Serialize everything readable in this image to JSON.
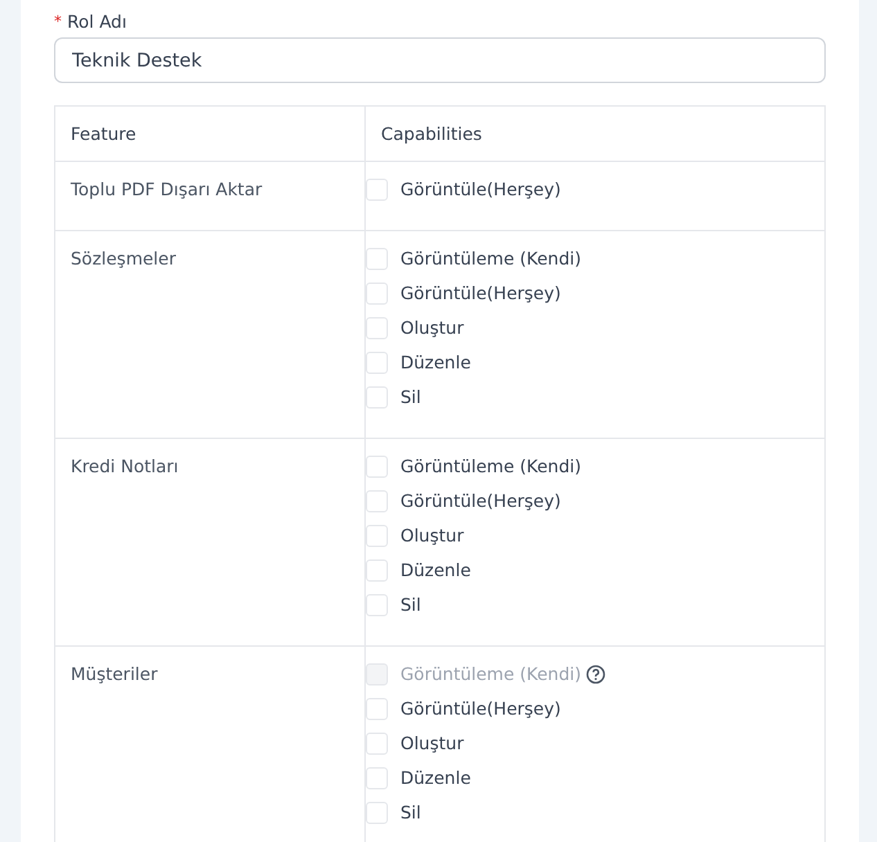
{
  "form": {
    "label": "Rol Adı",
    "required_mark": "*",
    "value": "Teknik Destek"
  },
  "table": {
    "columns": [
      "Feature",
      "Capabilities"
    ],
    "rows": [
      {
        "feature": "Toplu PDF Dışarı Aktar",
        "capabilities": [
          {
            "kind": "plain",
            "label": "Görüntüle(Herşey)",
            "checked": false,
            "disabled": false
          }
        ]
      },
      {
        "feature": "Sözleşmeler",
        "capabilities": [
          {
            "kind": "plain",
            "label": "Görüntüleme (Kendi)",
            "checked": false,
            "disabled": false
          },
          {
            "kind": "plain",
            "label": "Görüntüle(Herşey)",
            "checked": false,
            "disabled": false
          },
          {
            "kind": "plain",
            "label": "Oluştur",
            "checked": false,
            "disabled": false
          },
          {
            "kind": "plain",
            "label": "Düzenle",
            "checked": false,
            "disabled": false
          },
          {
            "kind": "plain",
            "label": "Sil",
            "checked": false,
            "disabled": false
          }
        ]
      },
      {
        "feature": "Kredi Notları",
        "capabilities": [
          {
            "kind": "plain",
            "label": "Görüntüleme (Kendi)",
            "checked": false,
            "disabled": false
          },
          {
            "kind": "plain",
            "label": "Görüntüle(Herşey)",
            "checked": false,
            "disabled": false
          },
          {
            "kind": "plain",
            "label": "Oluştur",
            "checked": false,
            "disabled": false
          },
          {
            "kind": "plain",
            "label": "Düzenle",
            "checked": false,
            "disabled": false
          },
          {
            "kind": "plain",
            "label": "Sil",
            "checked": false,
            "disabled": false
          }
        ]
      },
      {
        "feature": "Müşteriler",
        "capabilities": [
          {
            "kind": "help",
            "label": "Görüntüleme (Kendi)",
            "checked": false,
            "disabled": true
          },
          {
            "kind": "plain",
            "label": "Görüntüle(Herşey)",
            "checked": false,
            "disabled": false
          },
          {
            "kind": "plain",
            "label": "Oluştur",
            "checked": false,
            "disabled": false
          },
          {
            "kind": "plain",
            "label": "Düzenle",
            "checked": false,
            "disabled": false
          },
          {
            "kind": "plain",
            "label": "Sil",
            "checked": false,
            "disabled": false
          }
        ]
      }
    ]
  }
}
